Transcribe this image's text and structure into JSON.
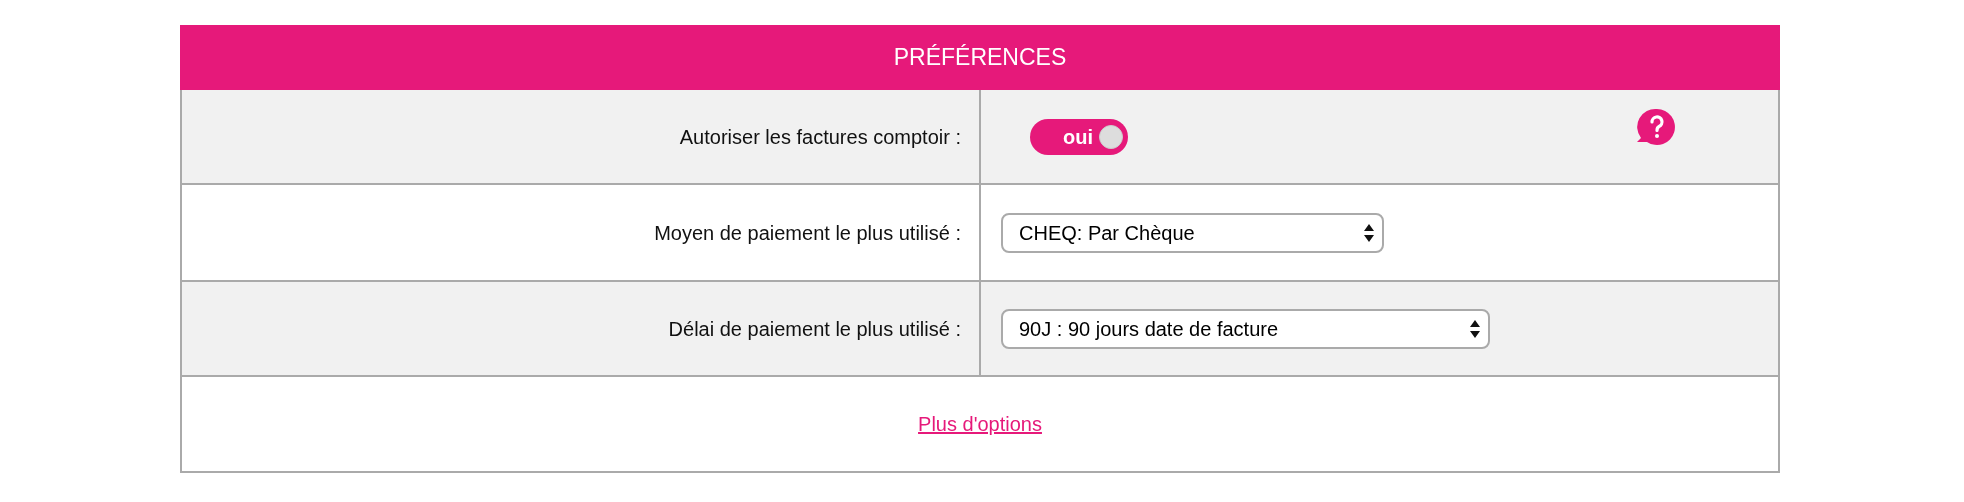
{
  "panel": {
    "title": "PRÉFÉRENCES",
    "rows": [
      {
        "kind": "toggle",
        "label": "Autoriser les factures comptoir :",
        "value": "oui",
        "on": true,
        "help": true
      },
      {
        "kind": "select",
        "label": "Moyen de paiement le plus utilisé :",
        "value": "CHEQ: Par Chèque"
      },
      {
        "kind": "select",
        "label": "Délai de paiement le plus utilisé :",
        "value": "90J : 90 jours date de facture"
      }
    ],
    "link": "Plus d'options"
  }
}
